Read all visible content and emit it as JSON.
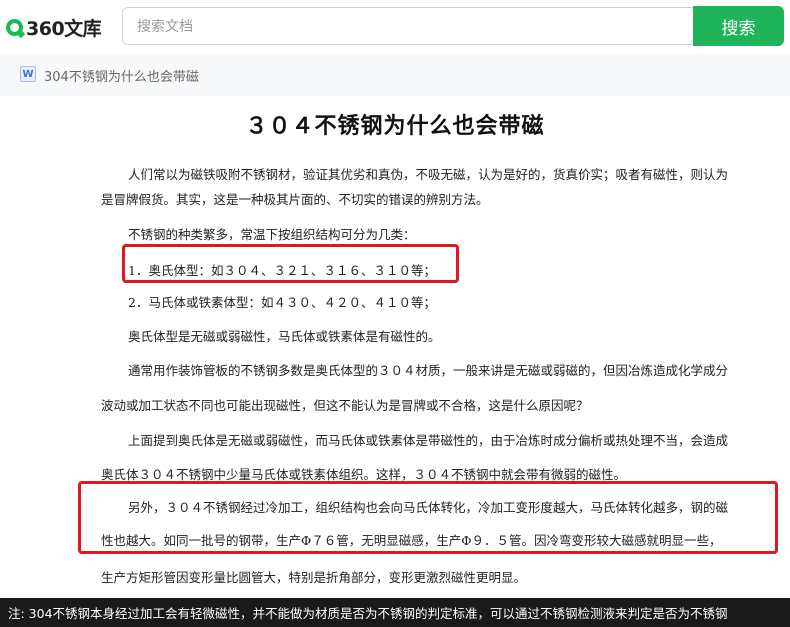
{
  "header": {
    "logo_text": "360文库",
    "search_placeholder": "搜索文档",
    "search_button": "搜索"
  },
  "breadcrumb": {
    "doc_type_icon": "W",
    "title": "304不锈钢为什么也会带磁"
  },
  "document": {
    "title": "３０４不锈钢为什么也会带磁",
    "lines": [
      "人们常以为磁铁吸附不锈钢材，验证其优劣和真伪，不吸无磁，认为是好的，货真价实；吸者有磁性，则认为",
      "是冒牌假货。其实，这是一种极其片面的、不切实的错误的辨别方法。",
      "不锈钢的种类繁多，常温下按组织结构可分为几类：",
      "1．奥氏体型：如３０４、３２１、３１６、３１０等；",
      "2．马氏体或铁素体型：如４３０、４２０、４１０等；",
      "奥氏体型是无磁或弱磁性，马氏体或铁素体是有磁性的。",
      "通常用作装饰管板的不锈钢多数是奥氏体型的３０４材质，一般来讲是无磁或弱磁的，但因冶炼造成化学成分",
      "波动或加工状态不同也可能出现磁性，但这不能认为是冒牌或不合格，这是什么原因呢？",
      "上面提到奥氏体是无磁或弱磁性，而马氏体或铁素体是带磁性的，由于冶炼时成分偏析或热处理不当，会造成",
      "奥氏体３０４不锈钢中少量马氏体或铁素体组织。这样，３０４不锈钢中就会带有微弱的磁性。",
      "另外，３０４不锈钢经过冷加工，组织结构也会向马氏体转化，冷加工变形度越大，马氏体转化越多，钢的磁",
      "性也越大。如同一批号的钢带，生产Φ７６管，无明显磁感，生产Φ９．５管。因冷弯变形较大磁感就明显一些，",
      "生产方矩形管因变形量比圆管大，特别是折角部分，变形更激烈磁性更明显。"
    ]
  },
  "caption": "注: 304不锈钢本身经过加工会有轻微磁性，并不能做为材质是否为不锈钢的判定标准，可以通过不锈钢检测液来判定是否为不锈钢",
  "colors": {
    "brand_green": "#1fb45a",
    "highlight_red": "#e0181e",
    "caption_bg": "#1a1a1a"
  }
}
